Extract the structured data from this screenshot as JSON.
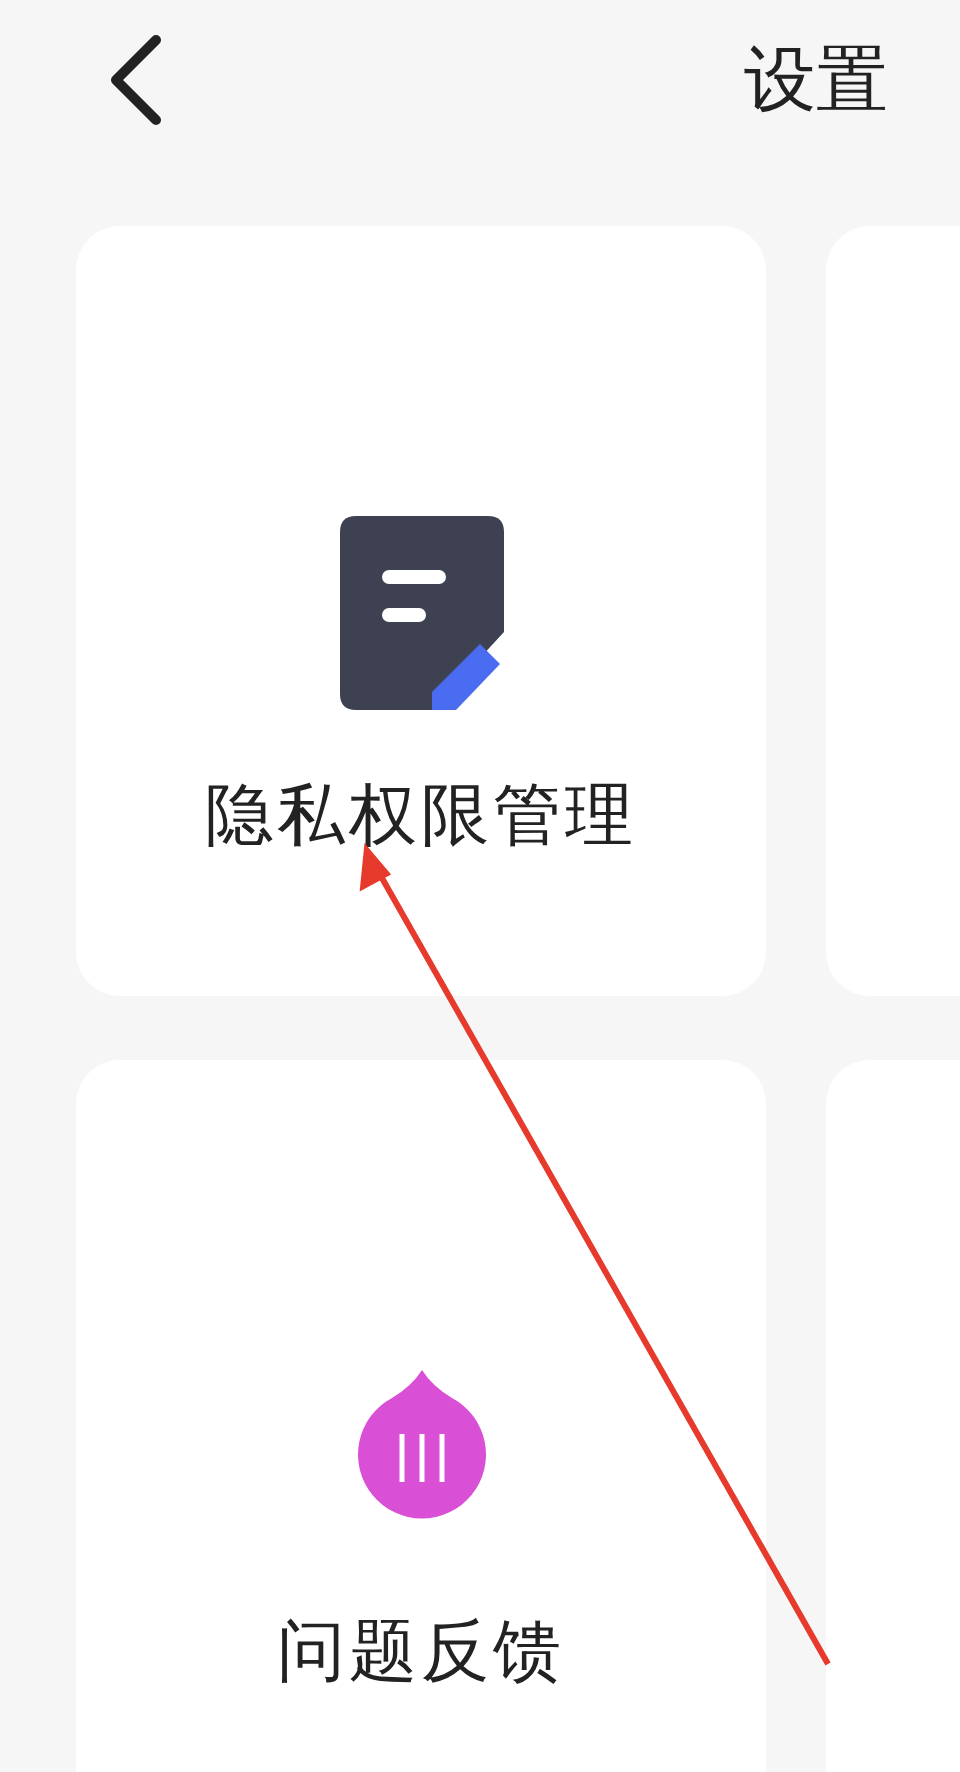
{
  "header": {
    "title": "设置"
  },
  "cards": [
    {
      "label": "隐私权限管理",
      "kind": "note"
    },
    {
      "label": "问题反馈",
      "kind": "drop"
    }
  ],
  "annotations": [
    {
      "kind": "arrow",
      "color": "#e53a2c"
    }
  ]
}
